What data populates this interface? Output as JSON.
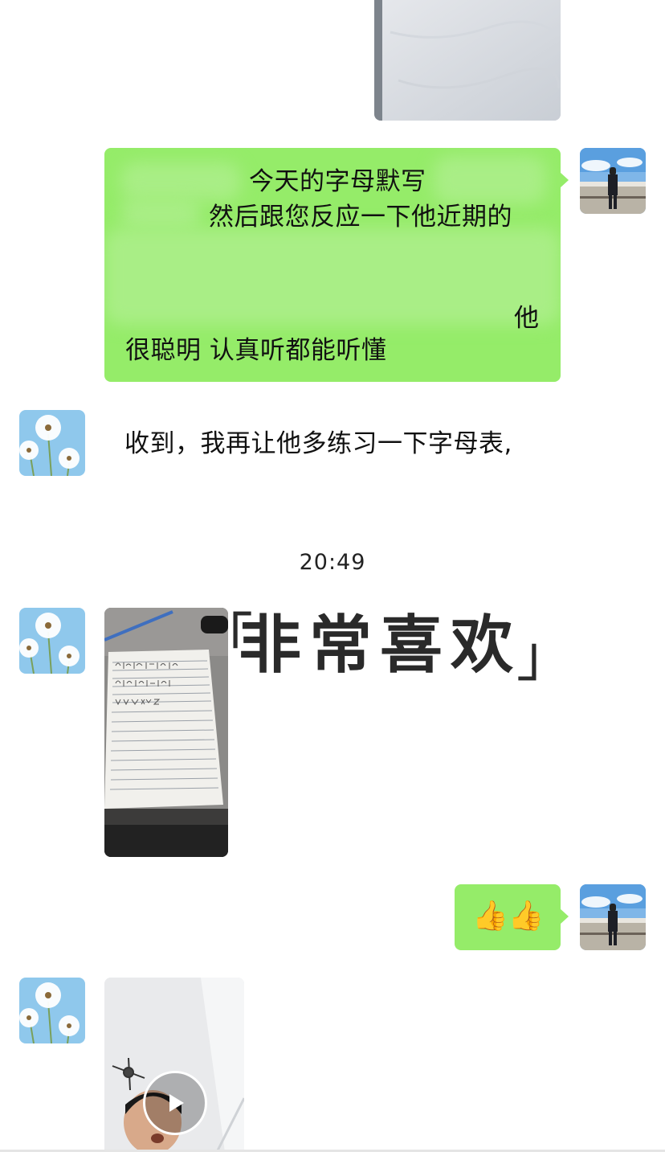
{
  "messages": {
    "m1_text_visible_line1": "今天的字母默写",
    "m1_text_visible_line2": "然后跟您反应一下他近期的",
    "m1_text_visible_line5": "他",
    "m1_text_visible_line6": "很聪明 认真听都能听懂",
    "m2_text": "收到，我再让他多练习一下字母表,",
    "timestamp": "20:49",
    "sticker_text": "非常喜欢",
    "thumbs_emoji": "👍👍"
  },
  "colors": {
    "outgoing_bubble": "#95ec69",
    "background": "#ffffff"
  },
  "icons": [
    "play-icon",
    "avatar-self",
    "avatar-contact-dandelion"
  ]
}
